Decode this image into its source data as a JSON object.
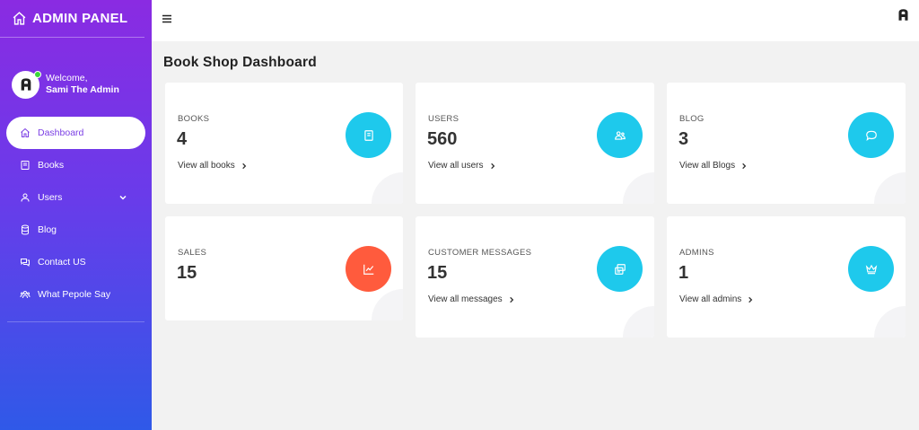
{
  "brand": {
    "title": "ADMIN PANEL",
    "icon": "home-icon"
  },
  "user": {
    "welcome": "Welcome,",
    "name": "Sami The Admin",
    "status_color": "#3bd63b"
  },
  "sidebar": {
    "items": [
      {
        "label": "Dashboard",
        "icon": "home-icon",
        "active": true
      },
      {
        "label": "Books",
        "icon": "book-icon"
      },
      {
        "label": "Users",
        "icon": "user-icon",
        "has_submenu": true
      },
      {
        "label": "Blog",
        "icon": "database-icon"
      },
      {
        "label": "Contact US",
        "icon": "chat-icon"
      },
      {
        "label": "What Pepole Say",
        "icon": "users-icon"
      }
    ]
  },
  "header": {
    "menu_icon": "hamburger-icon",
    "logo_icon": "logo-icon"
  },
  "main": {
    "title": "Book Shop Dashboard",
    "cards": [
      {
        "label": "BOOKS",
        "value": "4",
        "link": "View all books",
        "icon": "book-icon",
        "color": "#1ec9ec"
      },
      {
        "label": "USERS",
        "value": "560",
        "link": "View all users",
        "icon": "users-icon",
        "color": "#1ec9ec"
      },
      {
        "label": "BLOG",
        "value": "3",
        "link": "View all Blogs",
        "icon": "comment-icon",
        "color": "#1ec9ec"
      },
      {
        "label": "SALES",
        "value": "15",
        "link": "",
        "icon": "chart-icon",
        "color": "#ff5b3d"
      },
      {
        "label": "CUSTOMER MESSAGES",
        "value": "15",
        "link": "View all messages",
        "icon": "messages-icon",
        "color": "#1ec9ec"
      },
      {
        "label": "ADMINS",
        "value": "1",
        "link": "View all admins",
        "icon": "crown-icon",
        "color": "#1ec9ec"
      }
    ]
  },
  "colors": {
    "sidebar_top": "#8a2be2",
    "sidebar_bottom": "#2f59e8",
    "active_text": "#7b3fe4"
  }
}
